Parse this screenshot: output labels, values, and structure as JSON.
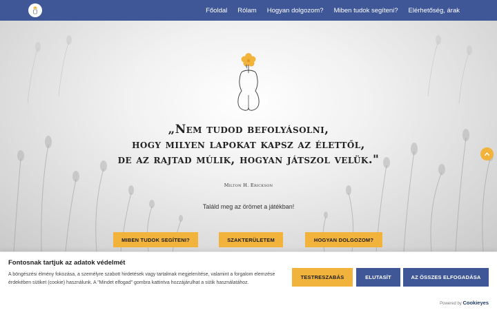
{
  "nav": {
    "logo_icon": "woman-flower-logo-icon",
    "items": [
      {
        "label": "Főoldal"
      },
      {
        "label": "Rólam"
      },
      {
        "label": "Hogyan dolgozom?"
      },
      {
        "label": "Miben tudok segíteni?"
      },
      {
        "label": "Elérhetőség, árak"
      }
    ]
  },
  "hero": {
    "illustration": "woman-with-flower-illustration",
    "quote_lines": [
      "„Nem tudod befolyásolni,",
      "hogy milyen lapokat kapsz az élettől,",
      "de az rajtad múlik, hogyan játszol velük.\""
    ],
    "author": "Milton H. Erickson",
    "tagline": "Találd meg az örömet a játékban!",
    "buttons": [
      {
        "label": "MIBEN TUDOK SEGÍTENI?"
      },
      {
        "label": "SZAKTERÜLETEM"
      },
      {
        "label": "HOGYAN DOLGOZOM?"
      }
    ],
    "scroll_top_icon": "chevron-up-icon"
  },
  "cookie": {
    "title": "Fontosnak tartjuk az adatok védelmét",
    "text": "A böngészési élmény fokozása, a személyre szabott hirdetések vagy tartalmak megjelenítése, valamint a forgalom elemzése érdekében sütiket (cookie) használunk. A \"Mindet elfogad\" gombra kattintva hozzájárulhat a sütik használatához.",
    "buttons": {
      "customize": "TESTRESZABÁS",
      "reject": "ELUTASÍT",
      "accept_all": "AZ ÖSSZES ELFOGADÁSA"
    },
    "powered_by": "Powered by",
    "brand": "Cookieyes"
  },
  "colors": {
    "nav_bg": "#3f5796",
    "accent_yellow": "#f2b33d"
  }
}
